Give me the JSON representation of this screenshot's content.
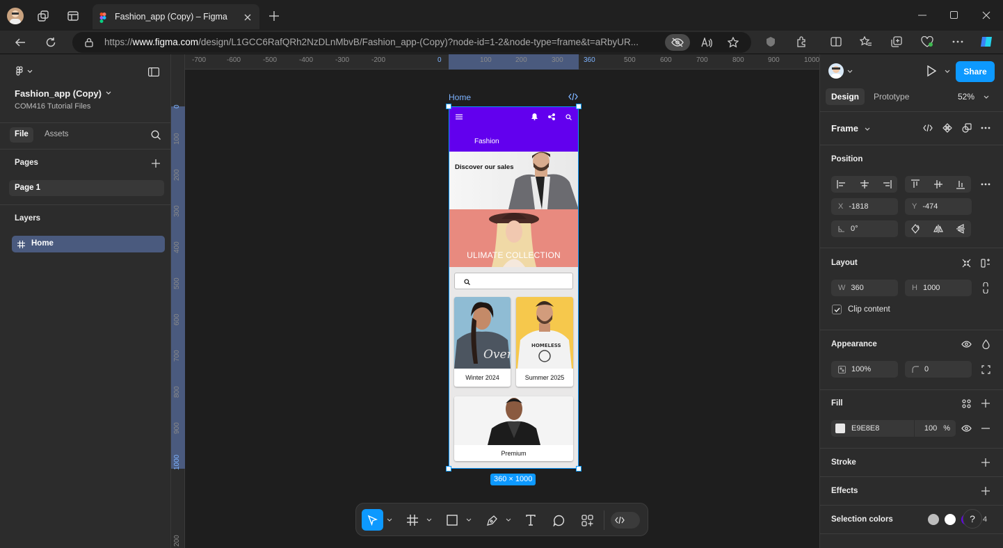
{
  "browser": {
    "tab_title": "Fashion_app (Copy) – Figma",
    "url_prefix": "https://",
    "url_domain": "www.figma.com",
    "url_path": "/design/L1GCC6RafQRh2NzDLnMbvB/Fashion_app-(Copy)?node-id=1-2&node-type=frame&t=aRbyUR..."
  },
  "file": {
    "name": "Fashion_app (Copy)",
    "team": "COM416 Tutorial Files"
  },
  "left_tabs": {
    "file": "File",
    "assets": "Assets"
  },
  "pages": {
    "title": "Pages",
    "items": [
      "Page 1"
    ]
  },
  "layers": {
    "title": "Layers",
    "items": [
      "Home"
    ]
  },
  "rulers": {
    "h_ticks": [
      "-700",
      "-600",
      "-500",
      "-400",
      "-300",
      "-200",
      "0",
      "100",
      "200",
      "300",
      "360",
      "500",
      "600",
      "700",
      "800",
      "900",
      "1000"
    ],
    "v_ticks": [
      "0",
      "100",
      "200",
      "300",
      "400",
      "500",
      "600",
      "700",
      "800",
      "900",
      "1000",
      "200"
    ]
  },
  "canvas": {
    "frame_label": "Home",
    "size_badge": "360 × 1000"
  },
  "phone": {
    "app_title": "Fashion",
    "banner1": "Discover our sales",
    "banner2": "ULIMATE COLLECTION",
    "cards": [
      "Winter 2024",
      "Summer 2025",
      "Premium"
    ],
    "header_color": "#6200ee",
    "banner2_color": "#e88a7f",
    "card_art": {
      "winter_tee": "Over",
      "summer_tee": "HOMELESS"
    }
  },
  "right": {
    "tabs": {
      "design": "Design",
      "prototype": "Prototype"
    },
    "zoom": "52%",
    "share": "Share",
    "frame_title": "Frame",
    "position": {
      "title": "Position",
      "x_label": "X",
      "x": "-1818",
      "y_label": "Y",
      "y": "-474",
      "rotation": "0°"
    },
    "layout": {
      "title": "Layout",
      "w_label": "W",
      "w": "360",
      "h_label": "H",
      "h": "1000",
      "clip": "Clip content"
    },
    "appearance": {
      "title": "Appearance",
      "opacity": "100%",
      "radius": "0"
    },
    "fill": {
      "title": "Fill",
      "hex": "E9E8E8",
      "opacity": "100",
      "pct": "%"
    },
    "stroke": {
      "title": "Stroke"
    },
    "effects": {
      "title": "Effects"
    },
    "selection_colors": {
      "title": "Selection colors",
      "count": "4"
    },
    "help": "?"
  },
  "colors": {
    "accent": "#0d99ff",
    "selection": "#4a5a7e"
  }
}
